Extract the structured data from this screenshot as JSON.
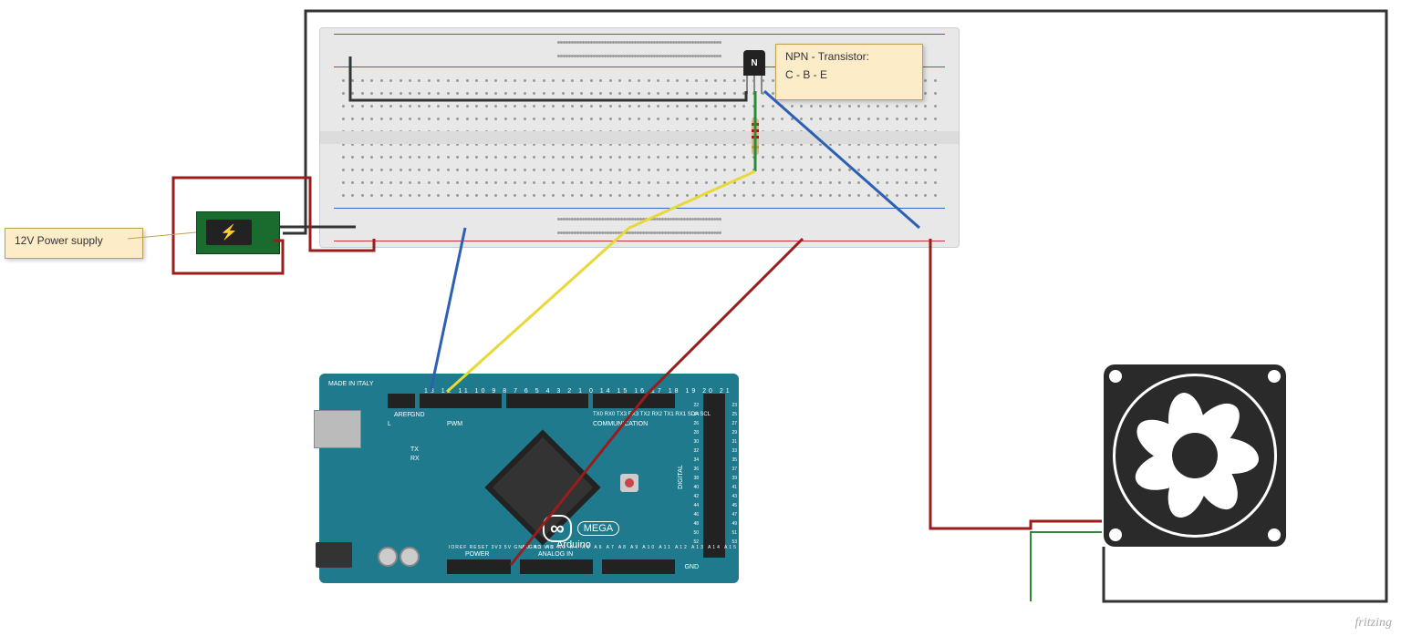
{
  "notes": {
    "psu": "12V Power supply",
    "transistor_title": "NPN - Transistor:",
    "transistor_pins": "C - B - E"
  },
  "transistor_mark": "N",
  "arduino": {
    "made_in": "MADE IN ITALY",
    "brand": "Arduino",
    "model": "MEGA",
    "pwm": "PWM",
    "communication": "COMMUNICATION",
    "digital": "DIGITAL",
    "power": "POWER",
    "analog_in": "ANALOG IN",
    "tx": "TX",
    "rx": "RX",
    "l": "L",
    "aref": "AREF",
    "gnd1": "GND",
    "pins_top": "13 12 11 10 9 8  7 6 5 4 3 2 1 0  14 15 16 17 18 19 20 21",
    "pins_comm": "TX0 RX0 TX3 RX3 TX2 RX2 TX1 RX1 SDA SCL",
    "pins_side_a": "22 24 26 28 30 32 34 36 38 40 42 44 46 48 50 52",
    "pins_side_b": "23 25 27 29 31 33 35 37 39 41 43 45 47 49 51 53",
    "pins_power": "IOREF RESET 3V3 5V GND GND VIN",
    "pins_analog": "A0 A1 A2 A3 A4 A5 A6 A7  A8 A9 A10 A11 A12 A13 A14 A15",
    "gnd2": "GND",
    "logo": "∞"
  },
  "watermark": "fritzing",
  "colors": {
    "wire_black": "#333333",
    "wire_red": "#9a1c1c",
    "wire_blue": "#2d5fb3",
    "wire_yellow": "#e8d838",
    "wire_green": "#2a8a3a",
    "note_bg": "#fdecc8",
    "arduino": "#1e7a8c",
    "breadboard": "#e8e8e8"
  }
}
